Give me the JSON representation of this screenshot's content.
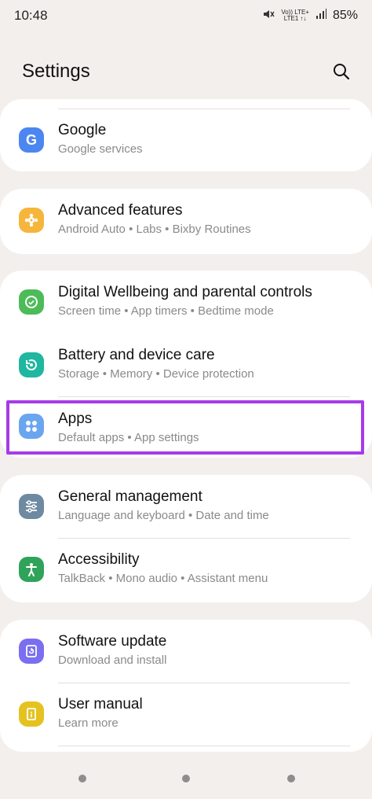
{
  "status": {
    "time": "10:48",
    "network_top": "Vo)) LTE+",
    "network_bottom": "LTE1 ↑↓",
    "battery": "85%"
  },
  "header": {
    "title": "Settings"
  },
  "items": [
    {
      "title": "Google",
      "subtitle": "Google services",
      "icon_color": "#4c86f0"
    },
    {
      "title": "Advanced features",
      "subtitle": "Android Auto  •  Labs  •  Bixby Routines",
      "icon_color": "#f5b63b"
    },
    {
      "title": "Digital Wellbeing and parental controls",
      "subtitle": "Screen time  •  App timers  •  Bedtime mode",
      "icon_color": "#4dbb58"
    },
    {
      "title": "Battery and device care",
      "subtitle": "Storage  •  Memory  •  Device protection",
      "icon_color": "#1fb7a0"
    },
    {
      "title": "Apps",
      "subtitle": "Default apps  •  App settings",
      "icon_color": "#6aa6ef"
    },
    {
      "title": "General management",
      "subtitle": "Language and keyboard  •  Date and time",
      "icon_color": "#6d8aa1"
    },
    {
      "title": "Accessibility",
      "subtitle": "TalkBack  •  Mono audio  •  Assistant menu",
      "icon_color": "#2fa35a"
    },
    {
      "title": "Software update",
      "subtitle": "Download and install",
      "icon_color": "#7a6ff0"
    },
    {
      "title": "User manual",
      "subtitle": "Learn more",
      "icon_color": "#e5c21f"
    }
  ],
  "highlight_color": "#a73be7"
}
